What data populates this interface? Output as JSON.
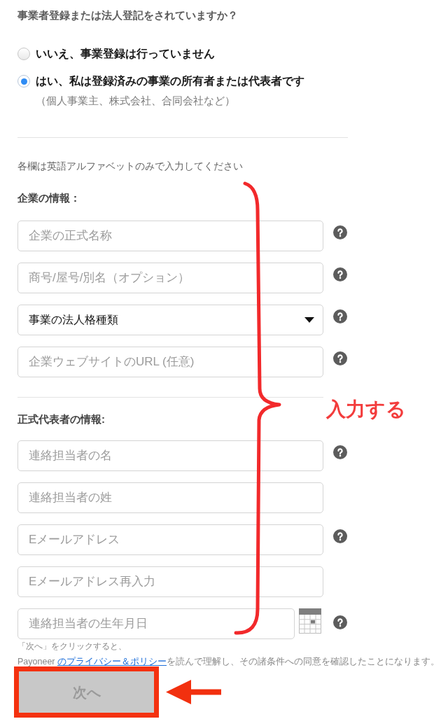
{
  "question": "事業者登録または法人登記をされていますか？",
  "options": [
    {
      "label": "いいえ、事業登録は行っていません",
      "selected": false
    },
    {
      "label": "はい、私は登録済みの事業の所有者または代表者です",
      "selected": true,
      "note": "（個人事業主、株式会社、合同会社など）"
    }
  ],
  "instruction": "各欄は英語アルファベットのみで入力してください",
  "sections": [
    {
      "heading": "企業の情報：",
      "fields": [
        {
          "kind": "text",
          "placeholder": "企業の正式名称",
          "help": true
        },
        {
          "kind": "text",
          "placeholder": "商号/屋号/別名（オプション）",
          "help": true
        },
        {
          "kind": "select",
          "value": "事業の法人格種類",
          "help": true
        },
        {
          "kind": "text",
          "placeholder": "企業ウェブサイトのURL (任意)",
          "help": true
        }
      ]
    },
    {
      "heading": "正式代表者の情報:",
      "fields": [
        {
          "kind": "text",
          "placeholder": "連絡担当者の名",
          "help": true
        },
        {
          "kind": "text",
          "placeholder": "連絡担当者の姓",
          "help": false
        },
        {
          "kind": "text",
          "placeholder": "Eメールアドレス",
          "help": true
        },
        {
          "kind": "text",
          "placeholder": "Eメールアドレス再入力",
          "help": false
        },
        {
          "kind": "date",
          "placeholder": "連絡担当者の生年月日",
          "help": true
        }
      ]
    }
  ],
  "consent": {
    "line_1": "「次へ」をクリックすると、",
    "before_link": "Payoneer",
    "link": "のプライバシー＆ポリシー",
    "after_link": "を読んで理解し、その諸条件への同意を確認したことになります。"
  },
  "next_button": {
    "label": "次へ",
    "disabled": true
  },
  "annotation": {
    "label": "入力する"
  }
}
